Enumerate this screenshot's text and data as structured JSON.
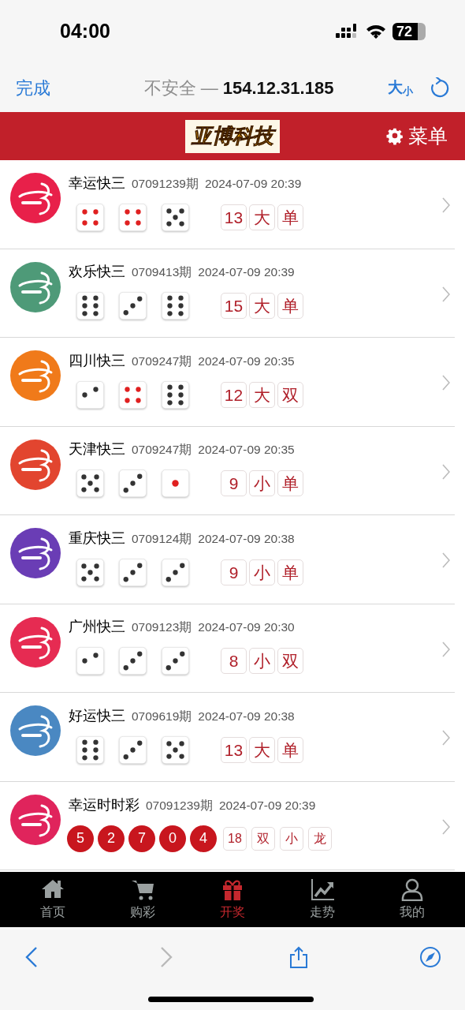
{
  "status_bar": {
    "time": "04:00",
    "battery": "72"
  },
  "browser_bar": {
    "done": "完成",
    "security": "不安全 —",
    "address": "154.12.31.185",
    "text_size": {
      "large": "大",
      "small": "小"
    }
  },
  "header": {
    "logo": "亚博科技",
    "menu": "菜单"
  },
  "draws": [
    {
      "kind": "dice",
      "name": "幸运快三",
      "period": "07091239期",
      "time": "2024-07-09 20:39",
      "color": "#e8204a",
      "faces": [
        {
          "kind": "four"
        },
        {
          "kind": "four"
        },
        {
          "kind": "five"
        }
      ],
      "results": [
        "13",
        "大",
        "单"
      ]
    },
    {
      "kind": "dice",
      "name": "欢乐快三",
      "period": "0709413期",
      "time": "2024-07-09 20:39",
      "color": "#4e9a78",
      "faces": [
        {
          "kind": "six"
        },
        {
          "kind": "three"
        },
        {
          "kind": "six"
        }
      ],
      "results": [
        "15",
        "大",
        "单"
      ]
    },
    {
      "kind": "dice",
      "name": "四川快三",
      "period": "0709247期",
      "time": "2024-07-09 20:35",
      "color": "#f07a1a",
      "faces": [
        {
          "kind": "two"
        },
        {
          "kind": "four"
        },
        {
          "kind": "six"
        }
      ],
      "results": [
        "12",
        "大",
        "双"
      ]
    },
    {
      "kind": "dice",
      "name": "天津快三",
      "period": "0709247期",
      "time": "2024-07-09 20:35",
      "color": "#e2452f",
      "faces": [
        {
          "kind": "five"
        },
        {
          "kind": "three"
        },
        {
          "kind": "one"
        }
      ],
      "results": [
        "9",
        "小",
        "单"
      ]
    },
    {
      "kind": "dice",
      "name": "重庆快三",
      "period": "0709124期",
      "time": "2024-07-09 20:38",
      "color": "#6a3db5",
      "faces": [
        {
          "kind": "five"
        },
        {
          "kind": "three"
        },
        {
          "kind": "three"
        }
      ],
      "results": [
        "9",
        "小",
        "单"
      ]
    },
    {
      "kind": "dice",
      "name": "广州快三",
      "period": "0709123期",
      "time": "2024-07-09 20:30",
      "color": "#e62b52",
      "faces": [
        {
          "kind": "two"
        },
        {
          "kind": "three"
        },
        {
          "kind": "three"
        }
      ],
      "results": [
        "8",
        "小",
        "双"
      ]
    },
    {
      "kind": "dice",
      "name": "好运快三",
      "period": "0709619期",
      "time": "2024-07-09 20:38",
      "color": "#4a88c2",
      "faces": [
        {
          "kind": "six"
        },
        {
          "kind": "three"
        },
        {
          "kind": "five"
        }
      ],
      "results": [
        "13",
        "大",
        "单"
      ]
    },
    {
      "kind": "balls",
      "name": "幸运时时彩",
      "period": "07091239期",
      "time": "2024-07-09 20:39",
      "color": "#e0245c",
      "balls": [
        "5",
        "2",
        "7",
        "0",
        "4"
      ],
      "results": [
        "18",
        "双",
        "小",
        "龙"
      ]
    }
  ],
  "tab_bar": [
    {
      "kind": "home",
      "label": "首页",
      "selected": false
    },
    {
      "kind": "cart",
      "label": "购彩",
      "selected": false
    },
    {
      "kind": "gift",
      "label": "开奖",
      "selected": true
    },
    {
      "kind": "trend",
      "label": "走势",
      "selected": false
    },
    {
      "kind": "user",
      "label": "我的",
      "selected": false
    }
  ],
  "toolbar": [
    {
      "kind": "back",
      "disabled": false
    },
    {
      "kind": "forward",
      "disabled": true
    },
    {
      "kind": "share",
      "disabled": false
    },
    {
      "kind": "compass",
      "disabled": false
    }
  ]
}
